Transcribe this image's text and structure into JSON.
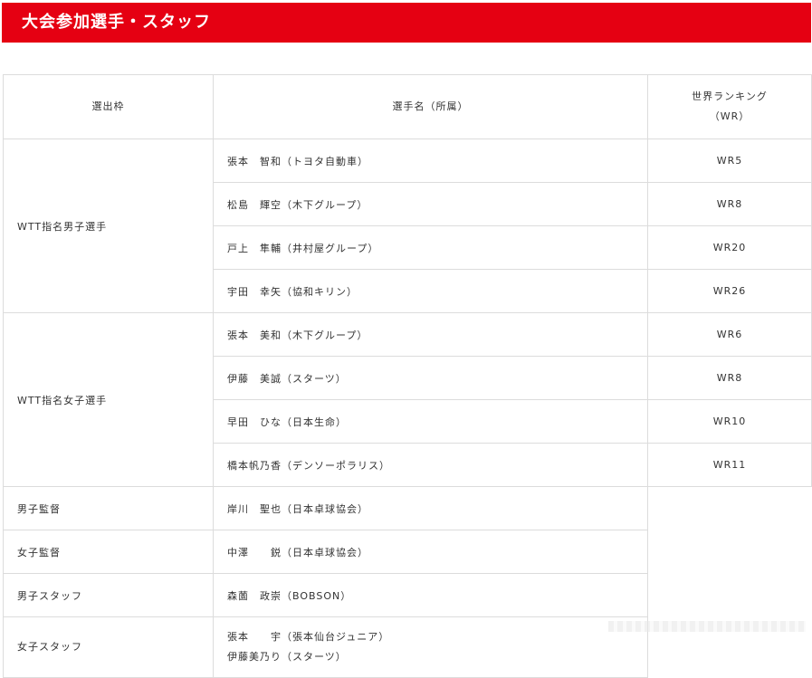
{
  "banner": {
    "title": "大会参加選手・スタッフ"
  },
  "table": {
    "headers": {
      "selection": "選出枠",
      "player": "選手名（所属）",
      "ranking_line1": "世界ランキング",
      "ranking_line2": "（WR）"
    },
    "groups": {
      "men_wtt": "WTT指名男子選手",
      "women_wtt": "WTT指名女子選手"
    },
    "rows": [
      {
        "name": "張本　智和（トヨタ自動車）",
        "wr": "WR5"
      },
      {
        "name": "松島　輝空（木下グループ）",
        "wr": "WR8"
      },
      {
        "name": "戸上　隼輔（井村屋グループ）",
        "wr": "WR20"
      },
      {
        "name": "宇田　幸矢（協和キリン）",
        "wr": "WR26"
      },
      {
        "name": "張本　美和（木下グループ）",
        "wr": "WR6"
      },
      {
        "name": "伊藤　美誠（スターツ）",
        "wr": "WR8"
      },
      {
        "name": "早田　ひな（日本生命）",
        "wr": "WR10"
      },
      {
        "name": "橋本帆乃香（デンソーポラリス）",
        "wr": "WR11"
      }
    ],
    "staff": [
      {
        "role": "男子監督",
        "name": "岸川　聖也（日本卓球協会）"
      },
      {
        "role": "女子監督",
        "name": "中澤　　鋭（日本卓球協会）"
      },
      {
        "role": "男子スタッフ",
        "name": "森薗　政崇（BOBSON）"
      },
      {
        "role": "女子スタッフ",
        "name_line1": "張本　　宇（張本仙台ジュニア）",
        "name_line2": "伊藤美乃り（スターツ）"
      }
    ]
  }
}
